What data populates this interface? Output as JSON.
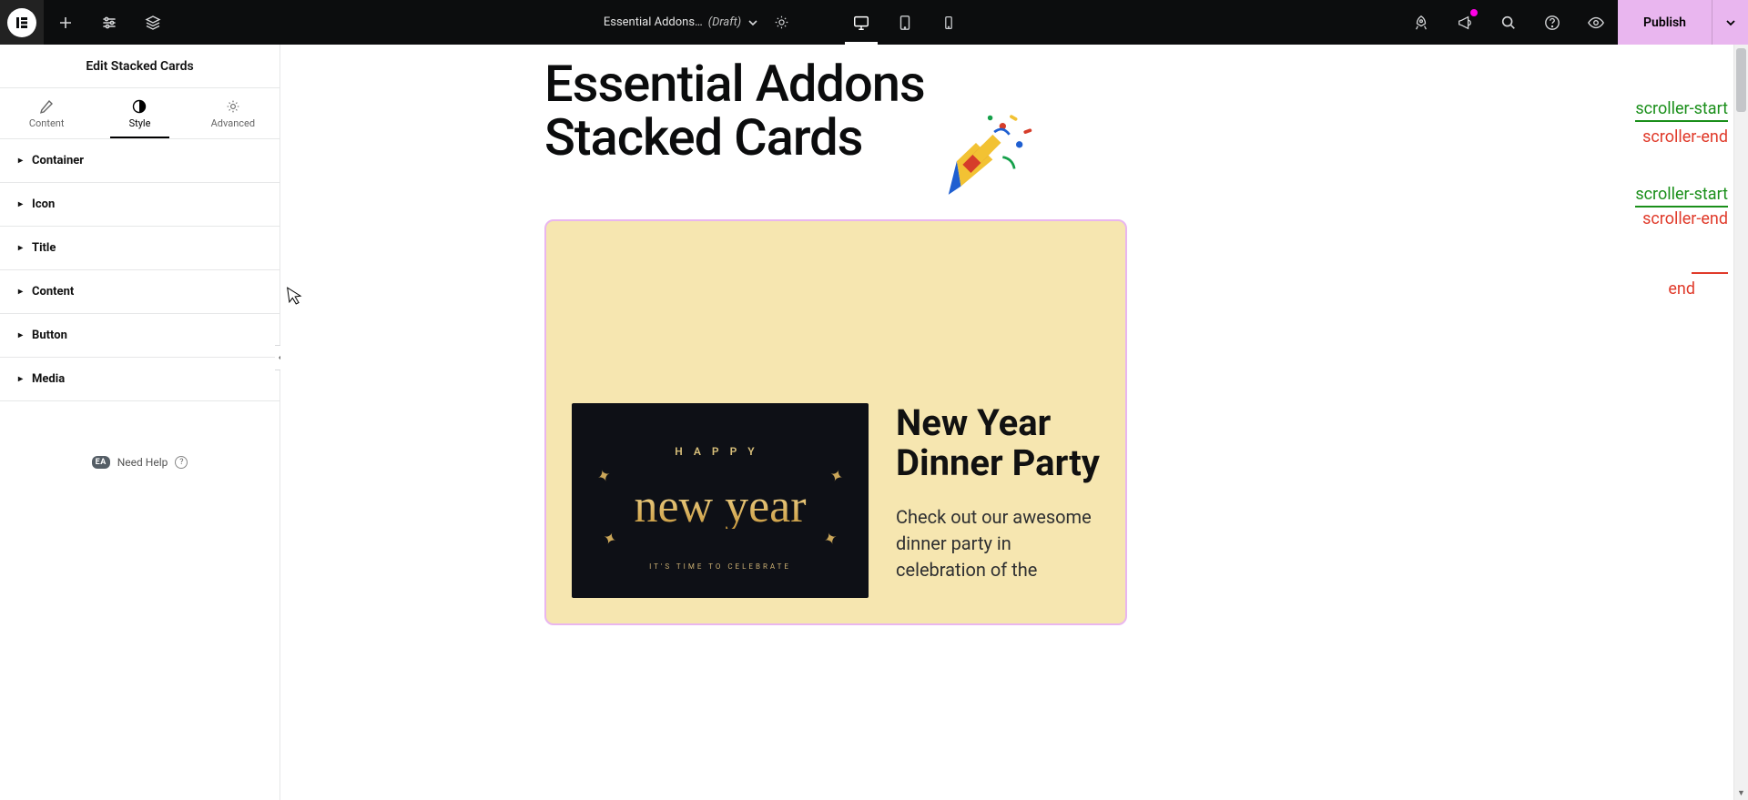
{
  "topbar": {
    "page_name": "Essential Addons…",
    "page_status": "(Draft)",
    "publish_label": "Publish"
  },
  "sidebar": {
    "panel_title": "Edit Stacked Cards",
    "tabs": {
      "content": "Content",
      "style": "Style",
      "advanced": "Advanced"
    },
    "sections": [
      "Container",
      "Icon",
      "Title",
      "Content",
      "Button",
      "Media"
    ],
    "help_label": "Need Help",
    "ea_badge": "EA"
  },
  "canvas": {
    "heading": "Essential Addons Stacked Cards",
    "card": {
      "title": "New Year Dinner Party",
      "body": "Check out our awesome dinner party in celebration of the",
      "media_line1": "HAPPY",
      "media_script": "new year",
      "media_sub": "IT'S TIME TO CELEBRATE"
    }
  },
  "markers": {
    "start": "scroller-start",
    "end": "scroller-end",
    "end_label": "end"
  }
}
